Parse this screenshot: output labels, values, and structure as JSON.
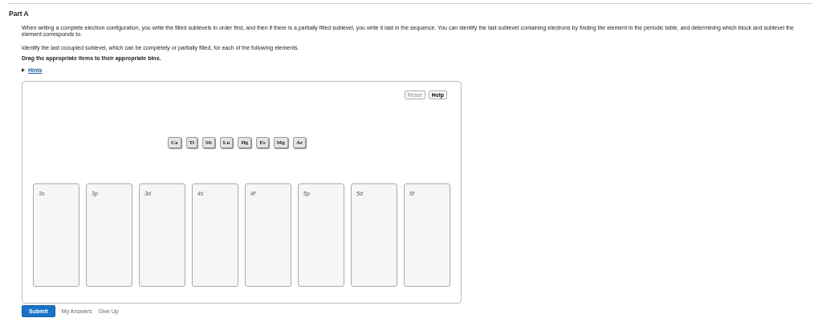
{
  "part_title": "Part A",
  "intro": "When writing a complete electron configuration, you write the filled sublevels in order first, and then if there is a partially filled sublevel, you write it last in the sequence. You can identify the last sublevel containing electrons by finding the element in the periodic table, and determining which block and sublevel the element corresponds to.",
  "question": "Identify the last occupied sublevel, which can be completely or partially filled, for each of the following elements.",
  "instruction": "Drag the appropriate items to their appropriate bins.",
  "hints": {
    "label": "Hints",
    "expanded": false
  },
  "toolbar": [
    {
      "label": "Reset",
      "disabled": true
    },
    {
      "label": "Help",
      "disabled": false
    }
  ],
  "items": [
    "Ca",
    "Ti",
    "Sb",
    "Lu",
    "Hg",
    "Es",
    "Mg",
    "Ar"
  ],
  "bins": [
    "3s",
    "3p",
    "3d",
    "4s",
    "4f",
    "5p",
    "5d",
    "5f"
  ],
  "actions": [
    {
      "label": "Submit",
      "kind": "primary"
    },
    {
      "label": "My Answers",
      "kind": "link"
    },
    {
      "label": "Give Up",
      "kind": "link"
    }
  ]
}
